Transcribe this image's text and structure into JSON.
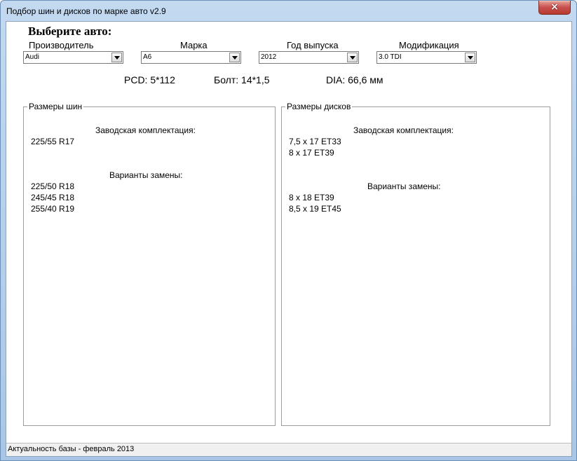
{
  "window": {
    "title": "Подбор шин и дисков по марке авто v2.9",
    "close_glyph": "×"
  },
  "heading": "Выберите авто:",
  "selectors": {
    "manufacturer": {
      "label": "Производитель",
      "value": "Audi"
    },
    "brand": {
      "label": "Марка",
      "value": "A6"
    },
    "year": {
      "label": "Год выпуска",
      "value": "2012"
    },
    "modification": {
      "label": "Модификация",
      "value": "3.0 TDI"
    }
  },
  "specs": {
    "pcd": "PCD: 5*112",
    "bolt": "Болт: 14*1,5",
    "dia": "DIA: 66,6 мм"
  },
  "tires": {
    "title": "Размеры шин",
    "factory_label": "Заводская комплектация:",
    "factory": [
      "225/55 R17"
    ],
    "alt_label": "Варианты замены:",
    "alternatives": [
      "225/50 R18",
      "245/45 R18",
      "255/40 R19"
    ]
  },
  "discs": {
    "title": "Размеры дисков",
    "factory_label": "Заводская комплектация:",
    "factory": [
      "7,5 x 17 ET33",
      "8 x 17 ET39"
    ],
    "alt_label": "Варианты замены:",
    "alternatives": [
      "8 x 18 ET39",
      "8,5 x 19 ET45"
    ]
  },
  "status": {
    "text": "Актуальность базы  - февраль 2013"
  }
}
